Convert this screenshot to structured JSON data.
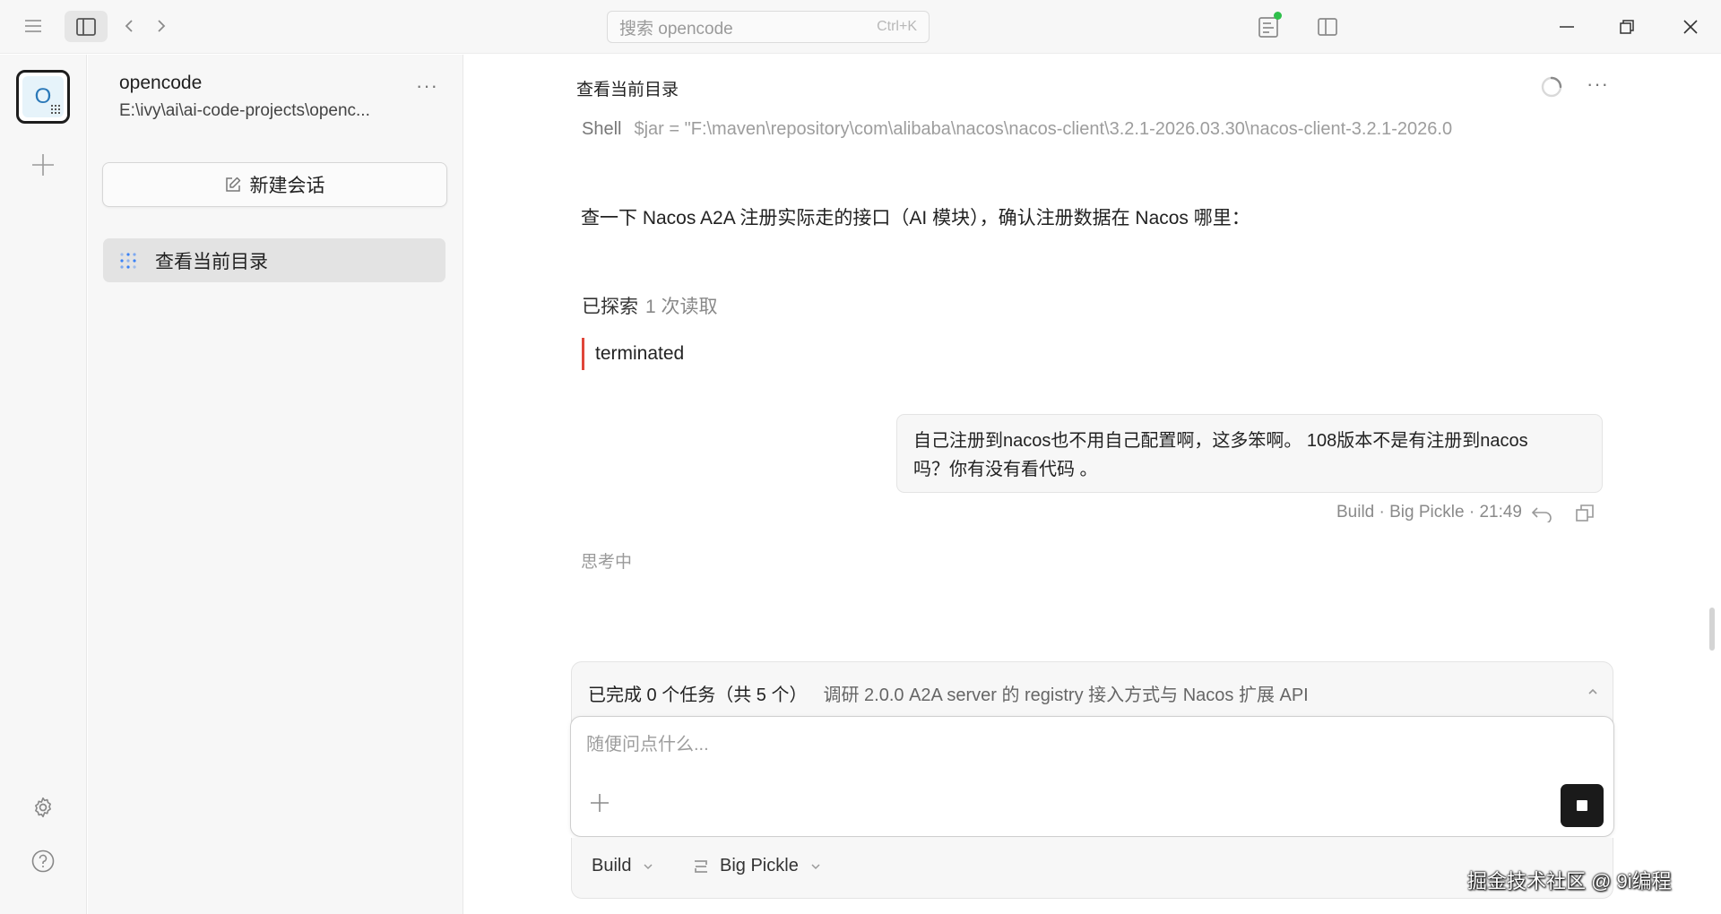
{
  "titlebar": {
    "search_placeholder": "搜索 opencode",
    "search_shortcut": "Ctrl+K",
    "status_dot_color": "#2fbf4b"
  },
  "rail": {
    "project_initial": "O"
  },
  "sidebar": {
    "project_name": "opencode",
    "project_path": "E:\\ivy\\ai\\ai-code-projects\\openc...",
    "more_label": "···",
    "new_session_label": "新建会话",
    "sessions": [
      {
        "title": "查看当前目录",
        "active": true
      }
    ]
  },
  "main": {
    "title": "查看当前目录",
    "more_label": "···",
    "messages": {
      "shell_label": "Shell",
      "shell_command": "$jar = \"F:\\maven\\repository\\com\\alibaba\\nacos\\nacos-client\\3.2.1-2026.03.30\\nacos-client-3.2.1-2026.0",
      "assistant_text": "查一下 Nacos A2A 注册实际走的接口（AI 模块），确认注册数据在 Nacos 哪里：",
      "explored_label": "已探索",
      "explored_detail": "1 次读取",
      "terminated_label": "terminated",
      "user_message_line1": "自己注册到nacos也不用自己配置啊，这多笨啊。 108版本不是有注册到nacos",
      "user_message_line2": "吗？你有没有看代码 。",
      "user_meta": "Build · Big Pickle · 21:49",
      "thinking_label": "思考中"
    },
    "task_bar": {
      "status": "已完成 0 个任务（共 5 个）",
      "current_task": "调研 2.0.0 A2A server 的 registry 接入方式与 Nacos 扩展 API"
    },
    "composer": {
      "placeholder": "随便问点什么...",
      "value": ""
    },
    "bottom_bar": {
      "agent": "Build",
      "model": "Big Pickle"
    }
  },
  "watermark": "掘金技术社区 @ 9i编程",
  "colors": {
    "accent_red": "#e0463a",
    "avatar_bg": "#e6f3fa",
    "avatar_text": "#2a78b8"
  }
}
